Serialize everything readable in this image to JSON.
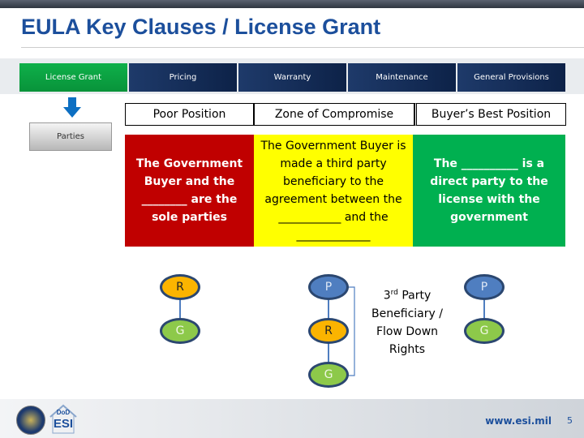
{
  "title": "EULA Key Clauses / License Grant",
  "tabs": [
    {
      "label": "License Grant"
    },
    {
      "label": "Pricing"
    },
    {
      "label": "Warranty"
    },
    {
      "label": "Maintenance"
    },
    {
      "label": "General Provisions"
    }
  ],
  "sub_button": "Parties",
  "headers": [
    "Poor Position",
    "Zone of Compromise",
    "Buyer’s Best Position"
  ],
  "zones": [
    {
      "text": "The Government Buyer and the ________ are the sole parties",
      "color": "#c00000"
    },
    {
      "text": "The Government Buyer is made a third party beneficiary to the agreement between the ___________ and the _____________",
      "color": "#ffff00"
    },
    {
      "text": "The __________ is a direct party to the license with the government",
      "color": "#00b050"
    }
  ],
  "nodes": {
    "left": [
      "R",
      "G"
    ],
    "middle": [
      "P",
      "R",
      "G"
    ],
    "right": [
      "P",
      "G"
    ]
  },
  "third_party_label": {
    "sup_prefix": "3",
    "sup": "rd",
    "rest": " Party Beneficiary / Flow Down Rights"
  },
  "footer": {
    "logo1": "DoD",
    "logo2": "ESI",
    "url": "www.esi.mil",
    "page": "5"
  }
}
